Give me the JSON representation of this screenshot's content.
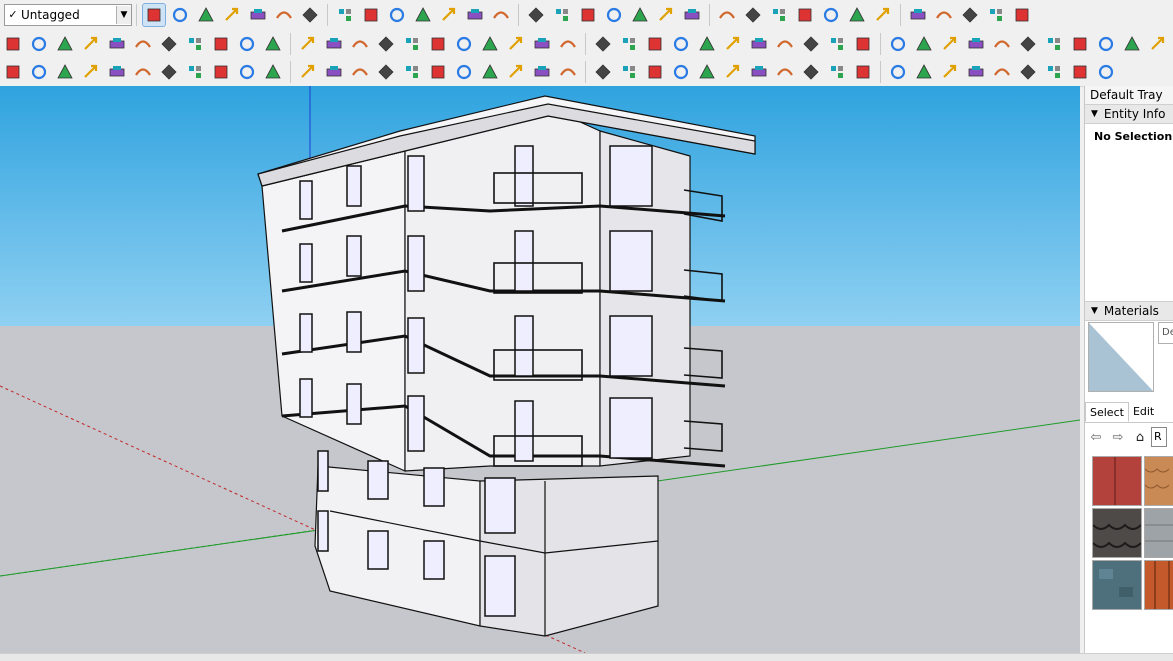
{
  "toolbar": {
    "tag_value": "Untagged",
    "tag_check": "✓",
    "row1_icons": [
      "select-icon",
      "eraser-icon",
      "line-icon",
      "arc-icon",
      "rectangle-icon",
      "push-pull-icon",
      "follow-me-icon",
      "move-icon",
      "rotate-icon",
      "scale-icon",
      "tape-icon",
      "text-icon",
      "paint-bucket-icon",
      "orbit-icon",
      "pan-icon",
      "zoom-icon",
      "zoom-extents-icon",
      "warehouse-icon",
      "extension-icon",
      "layers-icon",
      "solid-tools-icon",
      "account-icon",
      "iso-view-icon",
      "top-view-icon",
      "front-view-icon",
      "right-view-icon",
      "back-view-icon",
      "left-view-icon",
      "xray-style-icon",
      "wireframe-style-icon",
      "shaded-style-icon",
      "textured-style-icon",
      "profile-builder-icon"
    ],
    "row2_icons": [
      "section-plane-icon",
      "display-section-icon",
      "cut-icon",
      "fill-icon",
      "book-icon",
      "sandbox-icon",
      "curve-icon",
      "rect-frame-icon",
      "grid-icon",
      "flag-icon",
      "cabinet-icon",
      "weld-icon",
      "curviloft-icon",
      "vertex-icon",
      "plus-icon",
      "cross-icon",
      "tetra-icon",
      "pyramid-icon",
      "warning-icon",
      "loop-icon",
      "spring-icon",
      "orbit3d-icon",
      "bounce-icon",
      "arrow4-icon",
      "cylinder-icon",
      "undo-icon",
      "puzzle-icon",
      "copy-icon",
      "copy-red-icon",
      "copy-blue-icon",
      "cube-red-icon",
      "array-icon",
      "frame-icon",
      "tile-icon",
      "tile2-icon",
      "grid3-icon",
      "scatter-icon",
      "dots-icon",
      "grid4-icon",
      "stack-icon",
      "box-icon",
      "box2-icon",
      "box3-icon",
      "box4-icon"
    ],
    "row3_icons": [
      "sun-icon",
      "refresh-icon",
      "camera-icon",
      "add-icon",
      "tree-icon",
      "gradient-icon",
      "checker-icon",
      "cloud-icon",
      "gear-icon",
      "mail-icon",
      "info-icon",
      "bezier-icon",
      "polyline-icon",
      "weld2-icon",
      "clip-icon",
      "lasso-icon",
      "pipe-icon",
      "shell-icon",
      "sphere-icon",
      "coil-icon",
      "corner-icon",
      "angle-icon",
      "line-red-icon",
      "curve-red-icon",
      "arch-icon",
      "stair-icon",
      "grid-line-icon",
      "dome-icon",
      "ring-icon",
      "fan-icon",
      "stack-line-icon",
      "spread-icon",
      "spread2-icon",
      "spread3-icon",
      "bricks-icon",
      "stripes-icon",
      "frame2-icon",
      "flag2-icon",
      "hatch-icon",
      "hatch2-icon",
      "hatch3-icon",
      "hatch4-icon"
    ]
  },
  "tray": {
    "title": "Default Tray",
    "entity_info": {
      "label": "Entity Info",
      "status": "No Selection"
    },
    "materials": {
      "label": "Materials",
      "name_field": "De",
      "tabs": [
        "Select",
        "Edit"
      ],
      "library_field": "R",
      "swatches": [
        {
          "name": "red-metal-swatch",
          "color": "#b4423c"
        },
        {
          "name": "terracotta-shingle-swatch",
          "color": "#c98a55"
        },
        {
          "name": "slate-shingle-swatch",
          "color": "#4e4a48"
        },
        {
          "name": "grey-tile-swatch",
          "color": "#9ea3a8"
        },
        {
          "name": "blue-grey-stone-swatch",
          "color": "#4e6f7c"
        },
        {
          "name": "clay-tile-swatch",
          "color": "#c45a2c"
        }
      ]
    }
  },
  "viewport": {
    "sky_color": "#58b8e8",
    "ground_color": "#c6c7cc",
    "building": "five-storey-apartment-building"
  }
}
